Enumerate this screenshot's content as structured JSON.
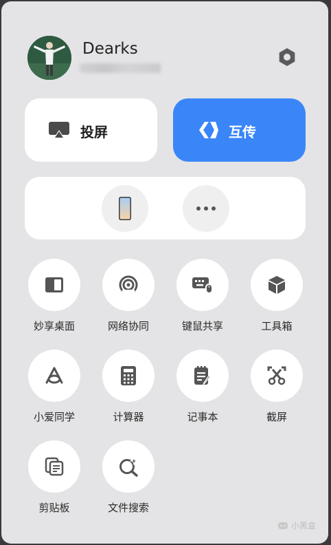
{
  "profile": {
    "username": "Dearks"
  },
  "cards": {
    "cast_label": "投屏",
    "transfer_label": "互传"
  },
  "colors": {
    "accent": "#3a86f8",
    "panel": "#e4e4e6",
    "card": "#ffffff",
    "icon": "#555555"
  },
  "devices": {
    "items": [
      {
        "icon": "phone-icon"
      },
      {
        "icon": "more-icon"
      }
    ]
  },
  "grid": {
    "items": [
      {
        "label": "妙享桌面",
        "icon": "desktop-icon"
      },
      {
        "label": "网络协同",
        "icon": "network-icon"
      },
      {
        "label": "键鼠共享",
        "icon": "keyboard-mouse-icon"
      },
      {
        "label": "工具箱",
        "icon": "toolbox-icon"
      },
      {
        "label": "小爱同学",
        "icon": "xiaoai-icon"
      },
      {
        "label": "计算器",
        "icon": "calculator-icon"
      },
      {
        "label": "记事本",
        "icon": "notepad-icon"
      },
      {
        "label": "截屏",
        "icon": "screenshot-icon"
      },
      {
        "label": "剪贴板",
        "icon": "clipboard-icon"
      },
      {
        "label": "文件搜索",
        "icon": "file-search-icon"
      }
    ]
  },
  "watermark": {
    "text": "小黑盒"
  }
}
